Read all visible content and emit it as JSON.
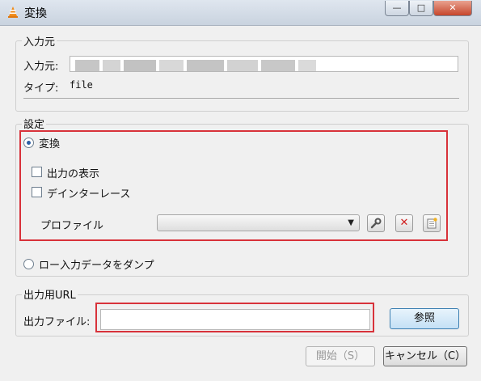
{
  "window": {
    "title": "変換",
    "min": "—",
    "max": "□",
    "close": "✕"
  },
  "source": {
    "group_title": "入力元",
    "input_label": "入力元:",
    "type_label": "タイプ:",
    "type_value": "file"
  },
  "settings": {
    "group_title": "設定",
    "convert_label": "変換",
    "show_output_label": "出力の表示",
    "deinterlace_label": "デインターレース",
    "profile_label": "プロファイル",
    "profile_value": "",
    "dump_raw_label": "ロー入力データをダンプ"
  },
  "destination": {
    "group_title": "出力用URL",
    "file_label": "出力ファイル:",
    "file_value": "",
    "browse_label": "参照"
  },
  "footer": {
    "start_label": "開始（S）",
    "cancel_label": "キャンセル（C）"
  },
  "colors": {
    "highlight": "#d8323a",
    "accent": "#2d5fa5"
  }
}
